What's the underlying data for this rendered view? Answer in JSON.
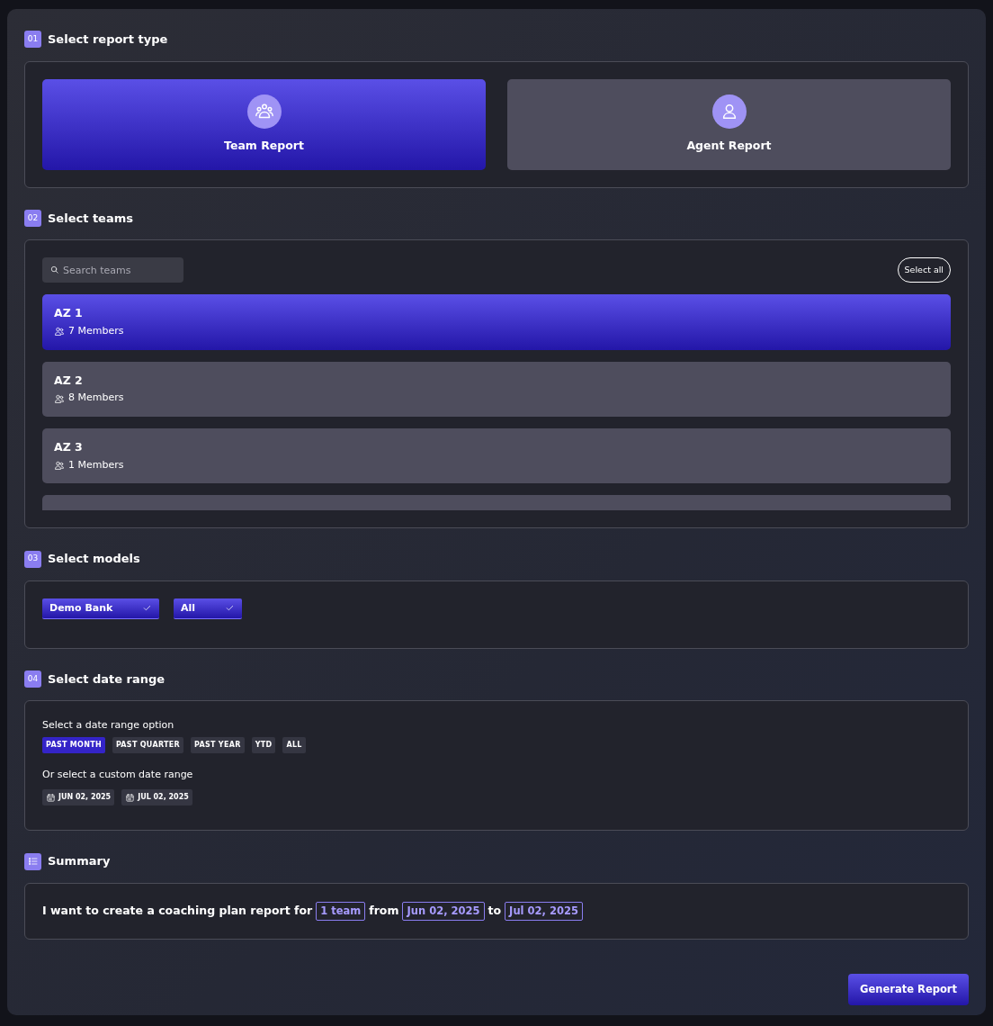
{
  "sections": [
    {
      "number": "01",
      "title": "Select report type"
    },
    {
      "number": "02",
      "title": "Select teams"
    },
    {
      "number": "03",
      "title": "Select models"
    },
    {
      "number": "04",
      "title": "Select date range"
    },
    {
      "title": "Summary"
    }
  ],
  "report_types": [
    {
      "label": "Team Report",
      "kind": "team",
      "selected": true
    },
    {
      "label": "Agent Report",
      "kind": "agent",
      "selected": false
    }
  ],
  "teams_search": {
    "placeholder": "Search teams"
  },
  "select_all": "Select all",
  "teams": [
    {
      "name": "AZ 1",
      "members": "7 Members",
      "selected": true
    },
    {
      "name": "AZ 2",
      "members": "8 Members",
      "selected": false
    },
    {
      "name": "AZ 3",
      "members": "1 Members",
      "selected": false
    },
    {
      "selected": false
    }
  ],
  "models": [
    {
      "label": "Demo Bank",
      "checked": true
    },
    {
      "label": "All",
      "checked": true
    }
  ],
  "date_range": {
    "options_label": "Select a date range option",
    "options": [
      {
        "label": "PAST MONTH",
        "selected": true
      },
      {
        "label": "PAST QUARTER",
        "selected": false
      },
      {
        "label": "PAST YEAR",
        "selected": false
      },
      {
        "label": "YTD",
        "selected": false
      },
      {
        "label": "ALL",
        "selected": false
      }
    ],
    "custom_label": "Or select a custom date range",
    "dates": [
      "JUN 02, 2025",
      "JUL 02, 2025"
    ]
  },
  "summary": [
    {
      "kind": "text",
      "text": "I want to create a coaching plan report for"
    },
    {
      "kind": "chip",
      "text": "1 team"
    },
    {
      "kind": "text",
      "text": "from"
    },
    {
      "kind": "chip",
      "text": "Jun 02, 2025"
    },
    {
      "kind": "text",
      "text": "to"
    },
    {
      "kind": "chip",
      "text": "Jul 02, 2025"
    }
  ],
  "generate_button": "Generate Report"
}
